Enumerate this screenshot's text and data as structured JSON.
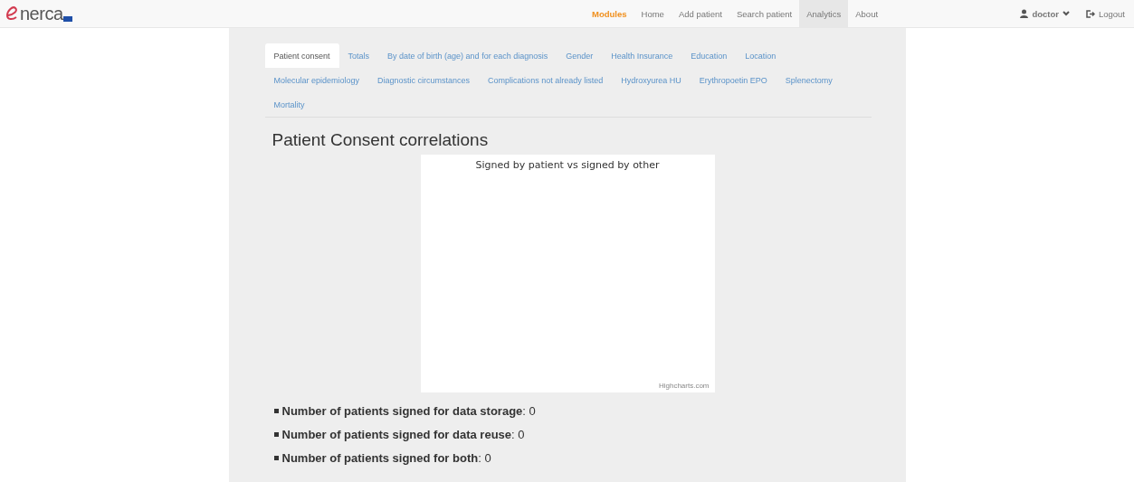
{
  "brand": {
    "name": "nerca"
  },
  "navbar": {
    "modules_label": "Modules",
    "items": [
      {
        "label": "Home",
        "selected": false
      },
      {
        "label": "Add patient",
        "selected": false
      },
      {
        "label": "Search patient",
        "selected": false
      },
      {
        "label": "Analytics",
        "selected": true
      },
      {
        "label": "About",
        "selected": false
      }
    ],
    "user": "doctor",
    "logout": "Logout"
  },
  "tabs": [
    {
      "label": "Patient consent",
      "selected": true
    },
    {
      "label": "Totals",
      "selected": false
    },
    {
      "label": "By date of birth (age) and for each diagnosis",
      "selected": false
    },
    {
      "label": "Gender",
      "selected": false
    },
    {
      "label": "Health Insurance",
      "selected": false
    },
    {
      "label": "Education",
      "selected": false
    },
    {
      "label": "Location",
      "selected": false
    },
    {
      "label": "Molecular epidemiology",
      "selected": false
    },
    {
      "label": "Diagnostic circumstances",
      "selected": false
    },
    {
      "label": "Complications not already listed",
      "selected": false
    },
    {
      "label": "Hydroxyurea HU",
      "selected": false
    },
    {
      "label": "Erythropoetin EPO",
      "selected": false
    },
    {
      "label": "Splenectomy",
      "selected": false
    },
    {
      "label": "Mortality",
      "selected": false
    }
  ],
  "heading": "Patient Consent correlations",
  "chart": {
    "title": "Signed by patient vs signed by other",
    "credit": "Highcharts.com"
  },
  "stats": [
    "**Number of patients signed for data storage**: 0",
    "**Number of patients signed for data reuse**: 0",
    "**Number of patients signed for both**: 0"
  ]
}
